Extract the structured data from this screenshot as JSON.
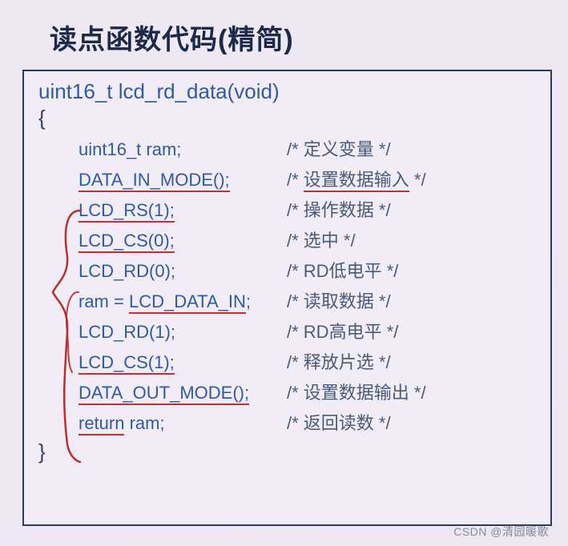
{
  "title": "读点函数代码(精简)",
  "signature": "uint16_t  lcd_rd_data(void)",
  "brace_open": "{",
  "brace_close": "}",
  "lines": [
    {
      "code_plain": "uint16_t ram;",
      "code_mid": "",
      "code_tail": "",
      "comment_pre": "/* ",
      "comment_mid": "定义变量",
      "comment_post": " */",
      "ul": false,
      "cul": false
    },
    {
      "code_plain": "",
      "code_mid": "DATA_IN_MODE();",
      "code_tail": "",
      "comment_pre": "/* ",
      "comment_mid": "设置数据输入",
      "comment_post": " */",
      "ul": true,
      "cul": true
    },
    {
      "code_plain": "",
      "code_mid": "LCD_RS(1);",
      "code_tail": "",
      "comment_pre": "/* ",
      "comment_mid": "操作数据",
      "comment_post": " */",
      "ul": true,
      "cul": false
    },
    {
      "code_plain": "",
      "code_mid": "LCD_CS(0);",
      "code_tail": "",
      "comment_pre": "/* ",
      "comment_mid": "选中",
      "comment_post": " */",
      "ul": true,
      "cul": false
    },
    {
      "code_plain": "",
      "code_mid": "LCD_RD(0);",
      "code_tail": "",
      "comment_pre": "/* ",
      "comment_mid": "RD低电平",
      "comment_post": " */",
      "ul": false,
      "cul": false
    },
    {
      "code_plain": "ram = ",
      "code_mid": "LCD_DATA_IN",
      "code_tail": ";",
      "comment_pre": "/* ",
      "comment_mid": "读取数据",
      "comment_post": " */",
      "ul": true,
      "cul": false
    },
    {
      "code_plain": "",
      "code_mid": "LCD_RD(1);",
      "code_tail": "",
      "comment_pre": "/* ",
      "comment_mid": "RD高电平",
      "comment_post": " */",
      "ul": false,
      "cul": false
    },
    {
      "code_plain": "",
      "code_mid": "LCD_CS(1);",
      "code_tail": "",
      "comment_pre": "/* ",
      "comment_mid": "释放片选",
      "comment_post": " */",
      "ul": true,
      "cul": false
    },
    {
      "code_plain": "",
      "code_mid": "DATA_OUT_MODE();",
      "code_tail": "",
      "comment_pre": "/* ",
      "comment_mid": "设置数据输出",
      "comment_post": " */",
      "ul": true,
      "cul": false
    },
    {
      "code_plain": "",
      "code_mid": "return",
      "code_tail": " ram;",
      "comment_pre": "/* ",
      "comment_mid": "返回读数",
      "comment_post": " */",
      "ul": true,
      "cul": false
    }
  ],
  "watermark": "CSDN @清园暖歌"
}
